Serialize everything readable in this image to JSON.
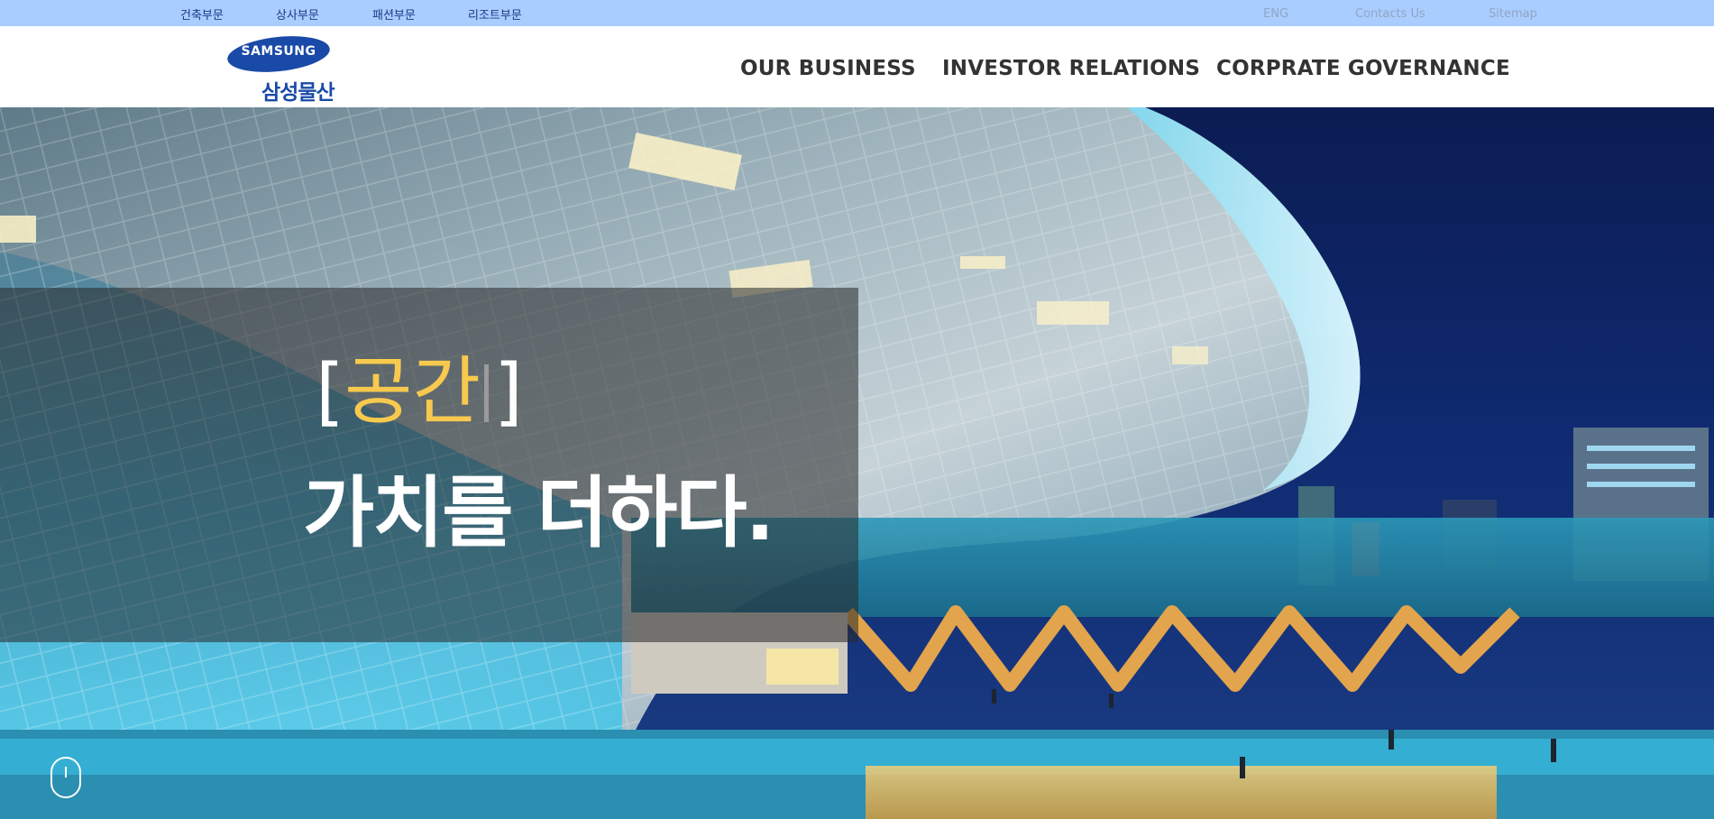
{
  "topbar": {
    "divisions": [
      "건축부문",
      "상사부문",
      "패션부문",
      "리조트부문"
    ],
    "utility": [
      "ENG",
      "Contacts Us",
      "Sitemap"
    ]
  },
  "header": {
    "logo": {
      "en": "SAMSUNG",
      "ko": "삼성물산"
    },
    "nav": [
      "OUR BUSINESS",
      "INVESTOR RELATIONS",
      "CORPRATE GOVERNANCE"
    ]
  },
  "hero": {
    "bracket_open": "[",
    "keyword": "공간",
    "bracket_close": "]",
    "tagline": "가치를 더하다."
  },
  "colors": {
    "topbar_bg": "#aacdff",
    "accent_yellow": "#f7c94e",
    "brand_blue": "#1a4aa8",
    "nav_text": "#333333"
  }
}
